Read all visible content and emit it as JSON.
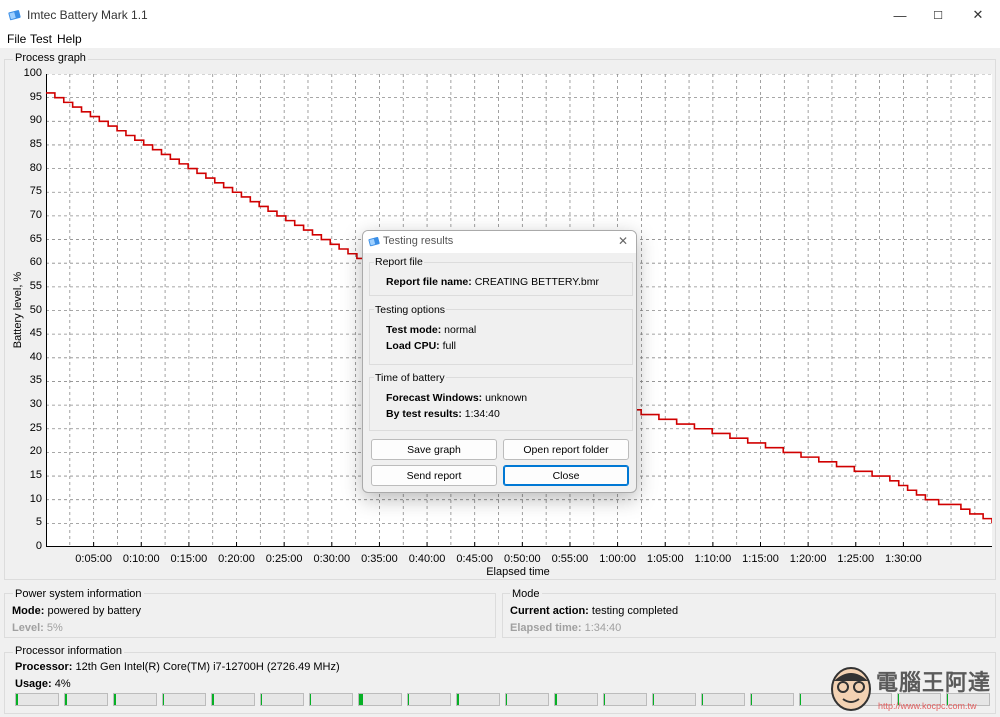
{
  "window": {
    "title": "Imtec Battery Mark 1.1",
    "controls": {
      "minimize": "—",
      "maximize": "☐",
      "close": "✕"
    }
  },
  "menu": [
    "File",
    "Test",
    "Help"
  ],
  "graph": {
    "group_title": "Process graph",
    "chart_data": {
      "type": "line",
      "xlabel": "Elapsed time",
      "ylabel": "Battery level, %",
      "ylim": [
        0,
        100
      ],
      "yticks": [
        0,
        5,
        10,
        15,
        20,
        25,
        30,
        35,
        40,
        45,
        50,
        55,
        60,
        65,
        70,
        75,
        80,
        85,
        90,
        95,
        100
      ],
      "xlim_minutes": [
        0,
        99.3
      ],
      "xticks": [
        "0:05:00",
        "0:10:00",
        "0:15:00",
        "0:20:00",
        "0:25:00",
        "0:30:00",
        "0:35:00",
        "0:40:00",
        "0:45:00",
        "0:50:00",
        "0:55:00",
        "1:00:00",
        "1:05:00",
        "1:10:00",
        "1:15:00",
        "1:20:00",
        "1:25:00",
        "1:30:00"
      ],
      "grid": true,
      "series": [
        {
          "color": "#d00000",
          "points": [
            [
              0,
              96
            ],
            [
              1,
              95
            ],
            [
              2,
              94
            ],
            [
              3,
              93
            ],
            [
              4,
              92
            ],
            [
              5,
              91
            ],
            [
              6,
              90
            ],
            [
              7,
              89
            ],
            [
              8,
              88
            ],
            [
              9,
              87
            ],
            [
              10,
              86
            ],
            [
              11,
              85
            ],
            [
              12,
              84
            ],
            [
              13,
              83
            ],
            [
              14,
              82
            ],
            [
              15,
              81
            ],
            [
              16,
              80
            ],
            [
              17,
              79
            ],
            [
              18,
              78
            ],
            [
              19,
              77
            ],
            [
              20,
              76
            ],
            [
              21,
              75
            ],
            [
              22,
              74
            ],
            [
              23,
              73
            ],
            [
              24,
              72
            ],
            [
              25,
              71
            ],
            [
              26,
              70
            ],
            [
              27,
              69
            ],
            [
              28,
              68
            ],
            [
              29,
              67
            ],
            [
              30,
              66
            ],
            [
              31,
              65
            ],
            [
              32,
              64
            ],
            [
              33,
              63
            ],
            [
              34,
              62
            ],
            [
              35,
              61
            ],
            [
              36,
              60
            ],
            [
              37,
              59
            ],
            [
              38,
              58
            ],
            [
              39,
              57
            ],
            [
              40,
              56
            ],
            [
              41,
              55
            ],
            [
              42,
              54
            ],
            [
              62,
              31
            ],
            [
              63,
              30
            ],
            [
              65,
              29
            ],
            [
              67,
              28
            ],
            [
              69,
              27
            ],
            [
              71,
              26
            ],
            [
              73,
              25
            ],
            [
              75,
              24
            ],
            [
              77,
              23
            ],
            [
              79,
              22
            ],
            [
              81,
              21
            ],
            [
              83,
              20
            ],
            [
              85,
              19
            ],
            [
              87,
              18
            ],
            [
              89,
              17
            ],
            [
              91,
              16
            ],
            [
              93,
              15
            ],
            [
              95,
              14
            ],
            [
              96,
              13
            ],
            [
              97,
              12
            ],
            [
              98,
              11
            ],
            [
              99,
              10
            ],
            [
              100.5,
              9
            ],
            [
              103,
              8
            ],
            [
              104,
              7
            ],
            [
              105.5,
              6
            ],
            [
              106.5,
              5
            ]
          ]
        }
      ]
    }
  },
  "power": {
    "group_title": "Power system information",
    "mode_label": "Mode:",
    "mode_value": "powered by battery",
    "level_label": "Level:",
    "level_value": "5%"
  },
  "mode": {
    "group_title": "Mode",
    "action_label": "Current action:",
    "action_value": "testing completed",
    "elapsed_label": "Elapsed time:",
    "elapsed_value": "1:34:40"
  },
  "processor": {
    "group_title": "Processor information",
    "name_label": "Processor:",
    "name_value": "12th Gen Intel(R) Core(TM) i7-12700H  (2726.49 MHz)",
    "usage_label": "Usage:",
    "usage_value": "4%",
    "core_usage": [
      0.05,
      0.05,
      0.05,
      0.03,
      0.05,
      0.03,
      0.03,
      0.08,
      0.02,
      0.05,
      0.02,
      0.05,
      0.03,
      0.03,
      0.03,
      0.03,
      0.02,
      0.03,
      0.03,
      0.03
    ]
  },
  "dialog": {
    "title": "Testing results",
    "close_glyph": "✕",
    "report_section": "Report file",
    "report_name_label": "Report file name:",
    "report_name_value": "CREATING BETTERY.bmr",
    "options_section": "Testing options",
    "test_mode_label": "Test mode:",
    "test_mode_value": "normal",
    "load_cpu_label": "Load CPU:",
    "load_cpu_value": "full",
    "time_section": "Time of battery",
    "forecast_label": "Forecast Windows:",
    "forecast_value": "unknown",
    "by_test_label": "By test results:",
    "by_test_value": "1:34:40",
    "buttons": {
      "save_graph": "Save graph",
      "open_folder": "Open report folder",
      "send_report": "Send report",
      "close": "Close"
    }
  },
  "watermark": {
    "text": "電腦王阿達",
    "url": "http://www.kocpc.com.tw"
  },
  "colors": {
    "line": "#d00000",
    "grid": "#8a8a8a",
    "cpu_fill": "#06b025",
    "accent": "#0078d4"
  }
}
